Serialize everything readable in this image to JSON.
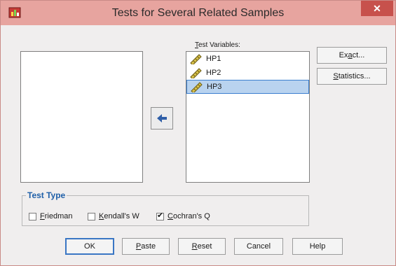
{
  "window": {
    "title": "Tests for Several Related Samples",
    "close_label": "✕"
  },
  "target_list": {
    "label_accel": "T",
    "label_rest": "est Variables:",
    "items": [
      {
        "label": "HP1",
        "selected": false
      },
      {
        "label": "HP2",
        "selected": false
      },
      {
        "label": "HP3",
        "selected": true
      }
    ]
  },
  "side_buttons": {
    "exact": {
      "pre": "Ex",
      "accel": "a",
      "post": "ct..."
    },
    "statistics": {
      "pre": "",
      "accel": "S",
      "post": "tatistics..."
    }
  },
  "test_type": {
    "title": "Test Type",
    "options": [
      {
        "accel": "F",
        "rest": "riedman",
        "checked": false
      },
      {
        "accel": "K",
        "rest": "endall's W",
        "checked": false
      },
      {
        "accel": "C",
        "rest": "ochran's Q",
        "checked": true
      }
    ]
  },
  "buttons": {
    "ok": "OK",
    "paste": {
      "accel": "P",
      "rest": "aste"
    },
    "reset": {
      "accel": "R",
      "rest": "eset"
    },
    "cancel": "Cancel",
    "help": "Help"
  },
  "icons": {
    "app": "spss-app-icon",
    "move": "arrow-left-icon",
    "variable": "ruler-scale-icon"
  },
  "colors": {
    "titlebar": "#e7a49f",
    "close": "#c7514c",
    "selection": "#b9d3ef",
    "group_title": "#1e5fa8"
  }
}
